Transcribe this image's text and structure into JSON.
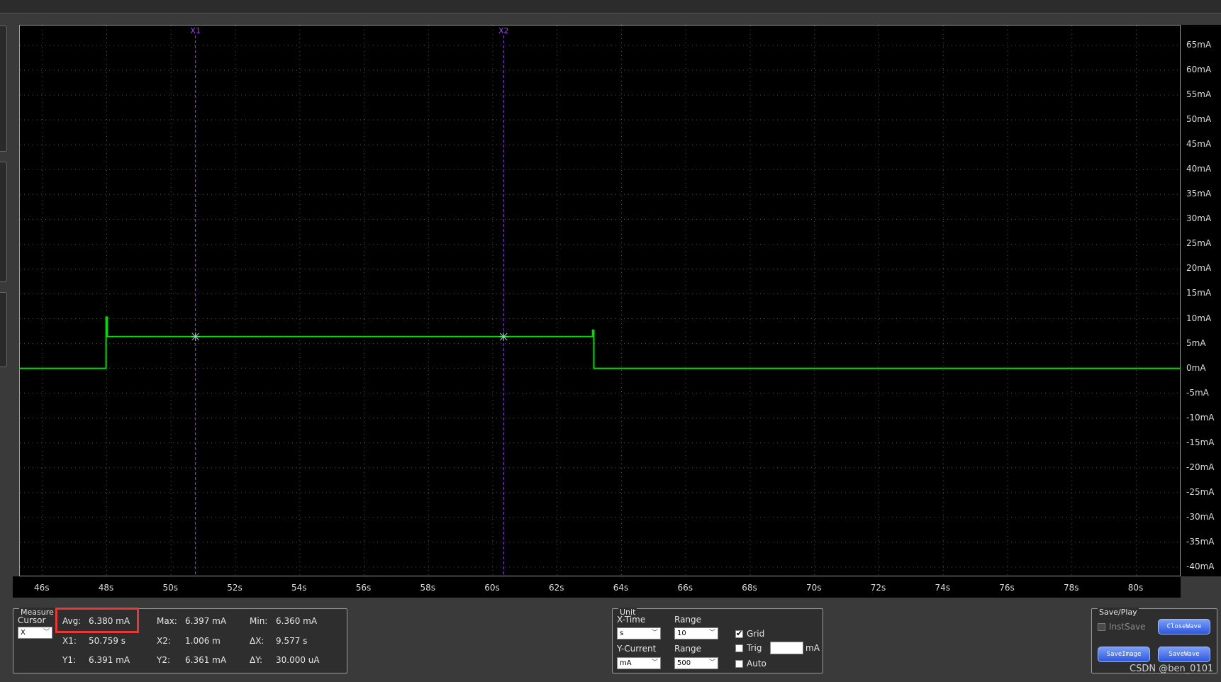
{
  "chart_data": {
    "type": "line",
    "xlabel": "",
    "ylabel": "",
    "xlim": [
      45.3,
      81.4
    ],
    "ylim": [
      -42,
      69
    ],
    "x_ticks": [
      "46s",
      "48s",
      "50s",
      "52s",
      "54s",
      "56s",
      "58s",
      "60s",
      "62s",
      "64s",
      "66s",
      "68s",
      "70s",
      "72s",
      "74s",
      "76s",
      "78s",
      "80s"
    ],
    "x_tick_values": [
      46,
      48,
      50,
      52,
      54,
      56,
      58,
      60,
      62,
      64,
      66,
      68,
      70,
      72,
      74,
      76,
      78,
      80
    ],
    "y_ticks": [
      "65mA",
      "60mA",
      "55mA",
      "50mA",
      "45mA",
      "40mA",
      "35mA",
      "30mA",
      "25mA",
      "20mA",
      "15mA",
      "10mA",
      "5mA",
      "0mA",
      "-5mA",
      "-10mA",
      "-15mA",
      "-20mA",
      "-25mA",
      "-30mA",
      "-35mA",
      "-40mA"
    ],
    "y_tick_values": [
      65,
      60,
      55,
      50,
      45,
      40,
      35,
      30,
      25,
      20,
      15,
      10,
      5,
      0,
      -5,
      -10,
      -15,
      -20,
      -25,
      -30,
      -35,
      -40
    ],
    "grid": true,
    "series": [
      {
        "color": "#00e000",
        "x": [
          45.3,
          47.98,
          47.98,
          48.02,
          48.02,
          63.1,
          63.1,
          63.14,
          63.14,
          81.4
        ],
        "y": [
          0,
          0,
          10.3,
          10.3,
          6.4,
          6.4,
          7.7,
          7.7,
          0,
          0
        ]
      }
    ],
    "cursors": [
      {
        "label": "X1",
        "x": 50.759,
        "y": 6.391,
        "color": "#a040ff"
      },
      {
        "label": "X2",
        "x": 60.336,
        "y": 6.361,
        "color": "#a040ff"
      }
    ]
  },
  "measure": {
    "title": "Measure",
    "cursor_label": "Cursor",
    "cursor_value": "X",
    "avg_label": "Avg:",
    "avg_value": "6.380 mA",
    "max_label": "Max:",
    "max_value": "6.397 mA",
    "min_label": "Min:",
    "min_value": "6.360 mA",
    "x1_label": "X1:",
    "x1_value": "50.759 s",
    "x2_label": "X2:",
    "x2_value": "1.006 m",
    "dx_label": "ΔX:",
    "dx_value": "9.577 s",
    "y1_label": "Y1:",
    "y1_value": "6.391 mA",
    "y2_label": "Y2:",
    "y2_value": "6.361 mA",
    "dy_label": "ΔY:",
    "dy_value": "30.000 uA"
  },
  "unit": {
    "title": "Unit",
    "xtime_label": "X-Time",
    "xtime_value": "s",
    "range1_label": "Range",
    "range1_value": "10",
    "ycurrent_label": "Y-Current",
    "ycurrent_value": "mA",
    "range2_label": "Range",
    "range2_value": "500",
    "grid_label": "Grid",
    "trig_label": "Trig",
    "trig_unit": "mA",
    "auto_label": "Auto"
  },
  "saveplay": {
    "title": "Save/Play",
    "instsave_label": "InstSave",
    "closewave_label": "CloseWave",
    "saveimage_label": "SaveImage",
    "savewave_label": "SaveWave"
  },
  "watermark": "CSDN @ben_0101",
  "colors": {
    "trace": "#00e000",
    "cursor": "#a040ff",
    "highlight": "#e53935",
    "button": "#2d57e0"
  }
}
